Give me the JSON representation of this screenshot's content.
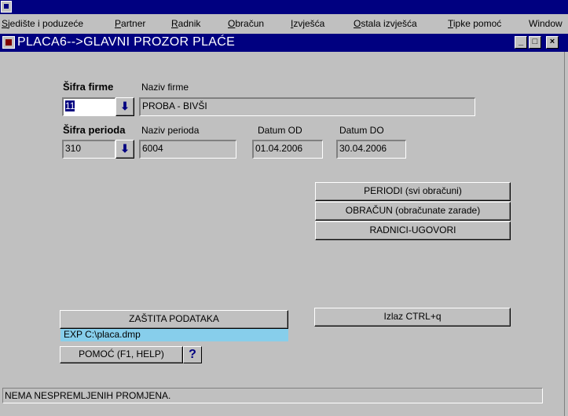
{
  "menu": {
    "items": [
      {
        "first": "S",
        "rest": "jedište i poduzeće"
      },
      {
        "first": "P",
        "rest": "artner"
      },
      {
        "first": "R",
        "rest": "adnik"
      },
      {
        "first": "O",
        "rest": "bračun"
      },
      {
        "first": "I",
        "rest": "zvješća"
      },
      {
        "first": "O",
        "rest": "stala izvješća"
      },
      {
        "first": "T",
        "rest": "ipke pomoć"
      },
      {
        "first": "",
        "rest": "Window"
      }
    ]
  },
  "window": {
    "title": "PLACA6-->GLAVNI PROZOR PLAĆE",
    "buttons": {
      "minimize": "_",
      "maximize": "□",
      "close": "×"
    }
  },
  "form": {
    "firm_code_label": "Šifra firme",
    "firm_name_label": "Naziv firme",
    "firm_code": "11",
    "firm_name": "PROBA - BIVŠI",
    "period_code_label": "Šifra perioda",
    "period_name_label": "Naziv perioda",
    "date_from_label": "Datum OD",
    "date_to_label": "Datum DO",
    "period_code": "310",
    "period_name": "6004",
    "date_from": "01.04.2006",
    "date_to": "30.04.2006",
    "lov_glyph": "⬇"
  },
  "actions": {
    "periods": "PERIODI (svi obračuni)",
    "calculation": "OBRAČUN (obračunate zarade)",
    "workers": "RADNICI-UGOVORI",
    "exit": "Izlaz CTRL+q",
    "data_protection": "ZAŠTITA PODATAKA",
    "export_text": "EXP C:\\placa.dmp",
    "help": "POMOĆ (F1, HELP)",
    "help_icon": "?"
  },
  "status": {
    "message": "NEMA NESPREMLJENIH PROMJENA."
  }
}
